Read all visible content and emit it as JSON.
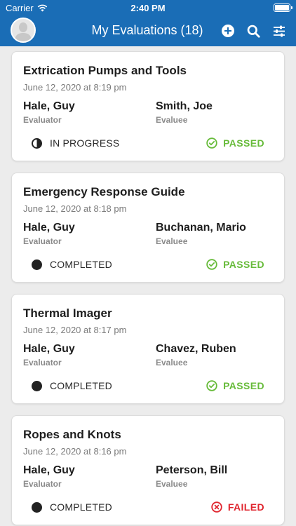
{
  "status_bar": {
    "carrier": "Carrier",
    "time": "2:40 PM"
  },
  "nav": {
    "title": "My Evaluations (18)",
    "icons": [
      "user-avatar",
      "add-circle-icon",
      "search-icon",
      "filter-sliders-icon"
    ]
  },
  "colors": {
    "brand": "#1a6db6",
    "passed": "#67bb3a",
    "failed": "#e0262f",
    "background": "#ececec"
  },
  "evaluations": [
    {
      "title": "Extrication Pumps and Tools",
      "date": "June 12, 2020 at 8:19 pm",
      "evaluator": "Hale, Guy",
      "evaluator_label": "Evaluator",
      "evaluee": "Smith, Joe",
      "evaluee_label": "Evaluee",
      "state": "IN PROGRESS",
      "result": "PASSED"
    },
    {
      "title": "Emergency Response Guide",
      "date": "June 12, 2020 at 8:18 pm",
      "evaluator": "Hale, Guy",
      "evaluator_label": "Evaluator",
      "evaluee": "Buchanan, Mario",
      "evaluee_label": "Evaluee",
      "state": "COMPLETED",
      "result": "PASSED"
    },
    {
      "title": "Thermal Imager",
      "date": "June 12, 2020 at 8:17 pm",
      "evaluator": "Hale, Guy",
      "evaluator_label": "Evaluator",
      "evaluee": "Chavez, Ruben",
      "evaluee_label": "Evaluee",
      "state": "COMPLETED",
      "result": "PASSED"
    },
    {
      "title": "Ropes and Knots",
      "date": "June 12, 2020 at 8:16 pm",
      "evaluator": "Hale, Guy",
      "evaluator_label": "Evaluator",
      "evaluee": "Peterson, Bill",
      "evaluee_label": "Evaluee",
      "state": "COMPLETED",
      "result": "FAILED"
    }
  ]
}
